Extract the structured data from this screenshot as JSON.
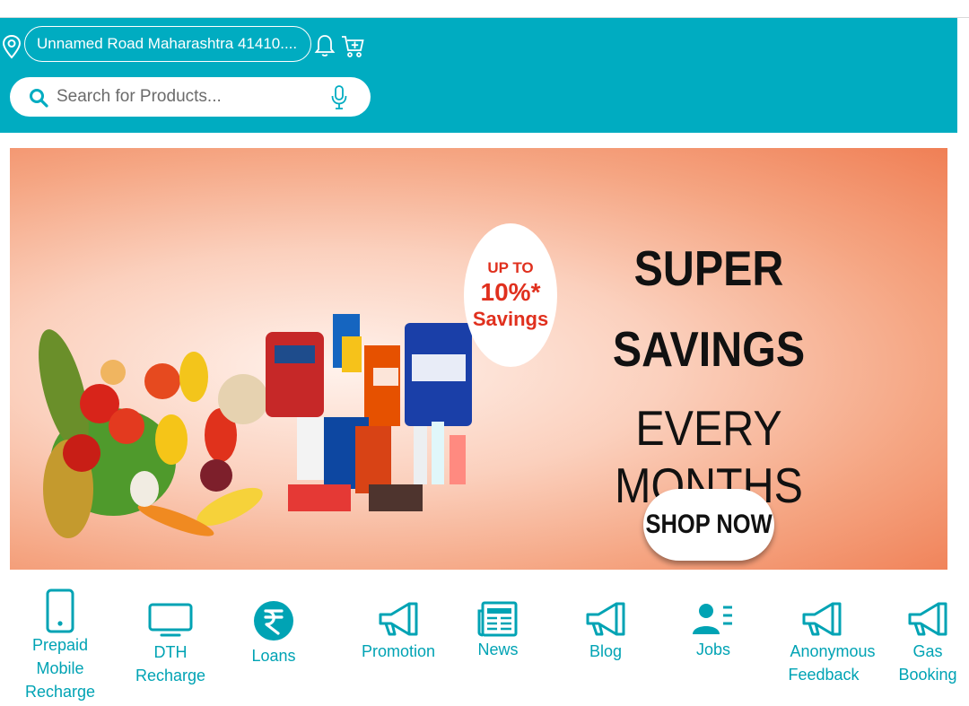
{
  "header": {
    "location": "Unnamed Road Maharashtra 41410....",
    "icons": [
      "location-pin-icon",
      "bell-icon",
      "cart-plus-icon"
    ],
    "accent_color": "#00acc1"
  },
  "search": {
    "placeholder": "Search for Products...",
    "icons": [
      "search-icon",
      "microphone-icon"
    ]
  },
  "banner": {
    "badge_line1": "UP TO",
    "badge_line2": "10%*",
    "badge_line3": "Savings",
    "headline_line1": "SUPER",
    "headline_line2": "SAVINGS",
    "headline_line3": "EVERY MONTHS",
    "cta": "SHOP NOW"
  },
  "quick_links": [
    {
      "label_lines": [
        "Prepaid",
        "Mobile",
        "Recharge"
      ],
      "icon": "mobile-phone-icon"
    },
    {
      "label_lines": [
        "DTH",
        "Recharge"
      ],
      "icon": "tv-icon"
    },
    {
      "label_lines": [
        "Loans"
      ],
      "icon": "rupee-icon"
    },
    {
      "label_lines": [
        "Promotion"
      ],
      "icon": "megaphone-icon"
    },
    {
      "label_lines": [
        "News"
      ],
      "icon": "newspaper-icon"
    },
    {
      "label_lines": [
        "Blog"
      ],
      "icon": "megaphone-icon"
    },
    {
      "label_lines": [
        "Jobs"
      ],
      "icon": "person-list-icon"
    },
    {
      "label_lines": [
        "Anonymous",
        "Feedback"
      ],
      "icon": "megaphone-icon"
    },
    {
      "label_lines": [
        "Gas",
        "Booking"
      ],
      "icon": "megaphone-icon"
    }
  ],
  "link_color": "#00a3b4"
}
